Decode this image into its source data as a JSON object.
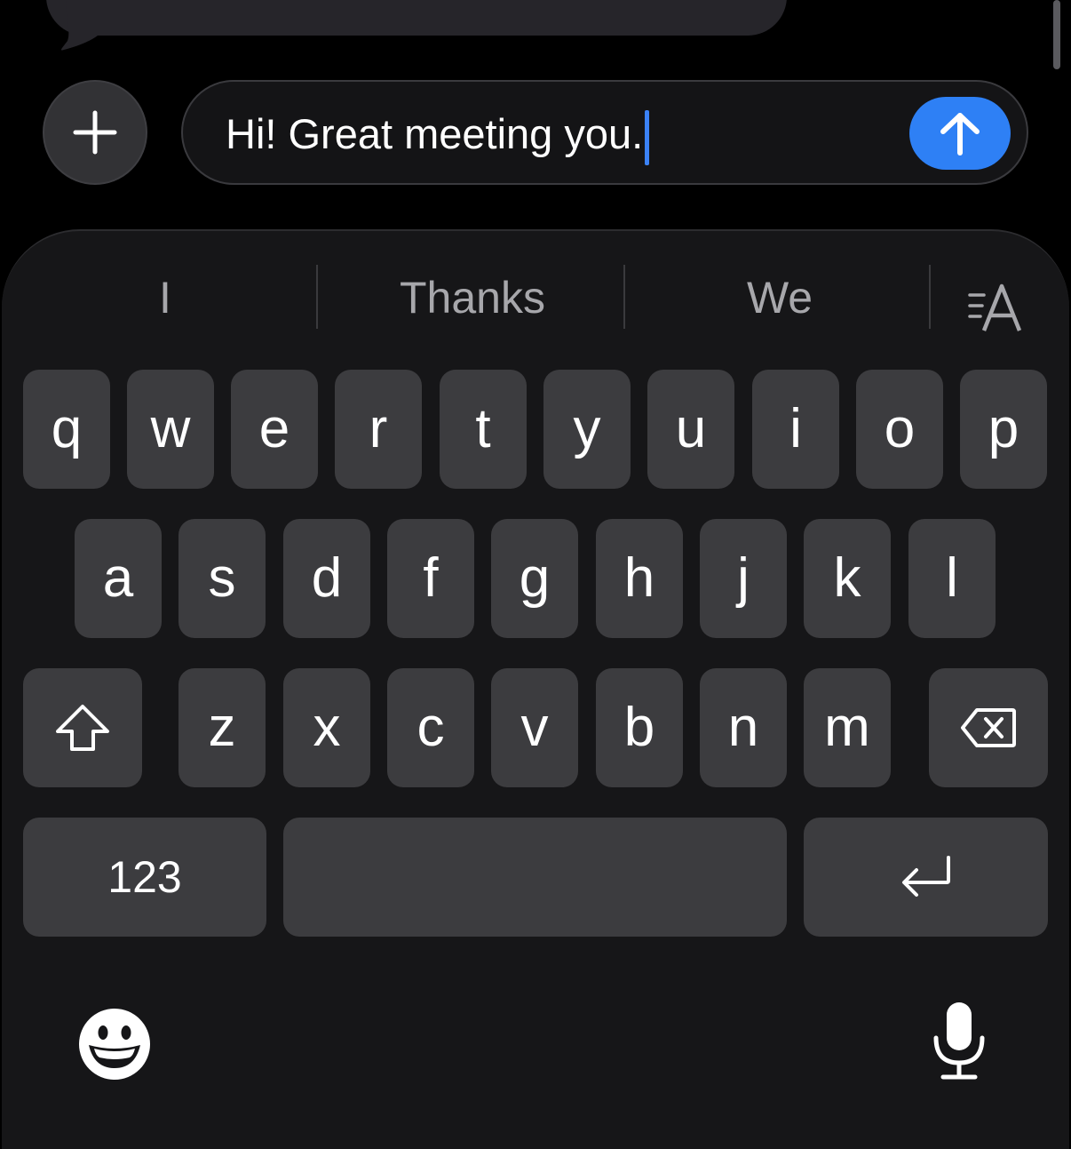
{
  "compose": {
    "message_text": "Hi! Great meeting you."
  },
  "icons": {
    "plus": "plus-icon",
    "send": "arrow-up-icon",
    "shift": "shift-icon",
    "delete": "delete-icon",
    "return": "return-icon",
    "format": "text-format-icon",
    "emoji": "emoji-icon",
    "mic": "microphone-icon"
  },
  "suggestions": [
    "I",
    "Thanks",
    "We"
  ],
  "keyboard": {
    "row1": [
      "q",
      "w",
      "e",
      "r",
      "t",
      "y",
      "u",
      "i",
      "o",
      "p"
    ],
    "row2": [
      "a",
      "s",
      "d",
      "f",
      "g",
      "h",
      "j",
      "k",
      "l"
    ],
    "row3": [
      "z",
      "x",
      "c",
      "v",
      "b",
      "n",
      "m"
    ],
    "numbers_label": "123"
  },
  "colors": {
    "accent": "#2e80f5",
    "key": "#3c3c3f",
    "keyboard_bg": "#161618"
  }
}
